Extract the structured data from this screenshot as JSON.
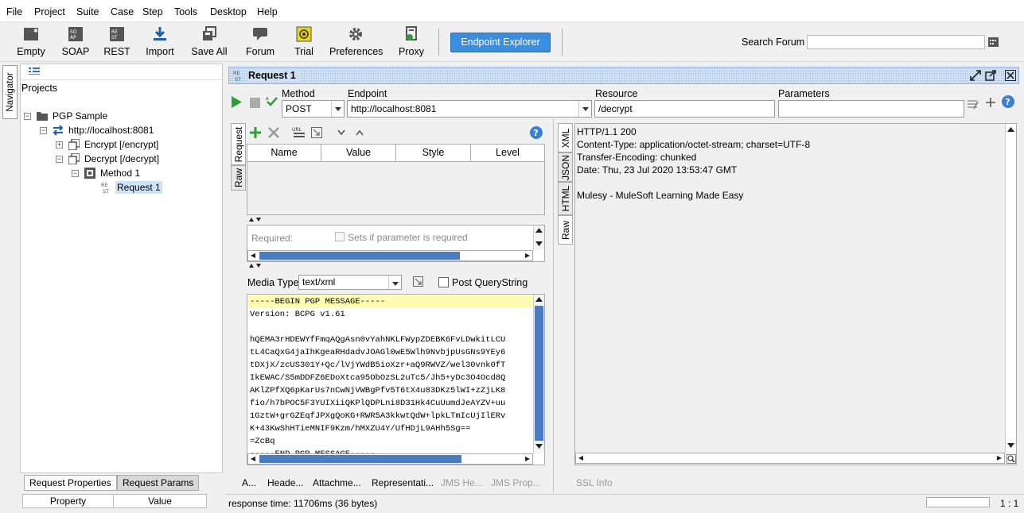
{
  "menu": [
    "File",
    "Project",
    "Suite",
    "Case",
    "Step",
    "Tools",
    "Desktop",
    "Help"
  ],
  "toolbar": {
    "items": [
      "Empty",
      "SOAP",
      "REST",
      "Import",
      "Save All",
      "Forum",
      "Trial",
      "Preferences",
      "Proxy"
    ],
    "endpoint_explorer": "Endpoint Explorer",
    "search_label": "Search Forum",
    "search_value": ""
  },
  "navigator": {
    "tab_label": "Navigator",
    "projects_label": "Projects",
    "tree": [
      "PGP Sample",
      "http://localhost:8081",
      "Encrypt [/encrypt]",
      "Decrypt [/decrypt]",
      "Method 1",
      "Request 1"
    ]
  },
  "bottom_panel": {
    "tabs": [
      "Request Properties",
      "Request Params"
    ],
    "columns": [
      "Property",
      "Value"
    ]
  },
  "request": {
    "title": "Request 1",
    "method_label": "Method",
    "method": "POST",
    "endpoint_label": "Endpoint",
    "endpoint": "http://localhost:8081",
    "resource_label": "Resource",
    "resource": "/decrypt",
    "parameters_label": "Parameters",
    "parameters": "",
    "side_tabs": [
      "Request",
      "Raw"
    ],
    "param_columns": [
      "Name",
      "Value",
      "Style",
      "Level"
    ],
    "required_label": "Required:",
    "required_checkbox": "Sets if parameter is required",
    "media_type_label": "Media Type",
    "media_type": "text/xml",
    "post_querystring": "Post QueryString",
    "body_lines": [
      "-----BEGIN PGP MESSAGE-----",
      "Version: BCPG v1.61",
      "",
      "hQEMA3rHDEWYfFmqAQgAsn0vYahNKLFWypZDEBK6FvLDwkitLCU",
      "tL4CaQxG4jaIhKgeaRHdadvJOAGl0wE5Wlh9NvbjpUsGNs9YEy6",
      "tDXjX/zcUS301Y+Qc/lVjYWdB5ioXzr+aQ9RWVZ/wel30vnk0fT",
      "IkEWAC/S5mDDFZ6EDoXtca95ObOzSL2uTc5/Jh5+yDc3O4Ocd8Q",
      "AKlZPfXQ6pKarUs7nCwNjVWBgPfv5T6tX4u83DKz5lWI+zZjLK8",
      "fio/h7bPOC5F3YUIXiiQKPlQDPLni8D31Hk4CuUumdJeAYZV+uu",
      "1GztW+grGZEqfJPXgQoKG+RWR5A3kkwtQdW+lpkLTmIcUjIlERv",
      "K+43KwShHTieMNIF9Kzm/hMXZU4Y/UfHDjL9AHh5Sg==",
      "=ZcBq",
      "-----END PGP MESSAGE-----"
    ],
    "bottom_tabs": [
      "A...",
      "Heade...",
      "Attachme...",
      "Representati...",
      "JMS He...",
      "JMS Prop..."
    ]
  },
  "response": {
    "side_tabs": [
      "XML",
      "JSON",
      "HTML",
      "Raw"
    ],
    "lines": [
      "HTTP/1.1 200",
      "Content-Type: application/octet-stream; charset=UTF-8",
      "Transfer-Encoding: chunked",
      "Date: Thu, 23 Jul 2020 13:53:47 GMT",
      "",
      "Mulesy - MuleSoft Learning Made Easy"
    ],
    "bottom_tab": "SSL Info"
  },
  "status": {
    "response_time": "response time: 11706ms (36 bytes)",
    "position": "1 : 1"
  }
}
